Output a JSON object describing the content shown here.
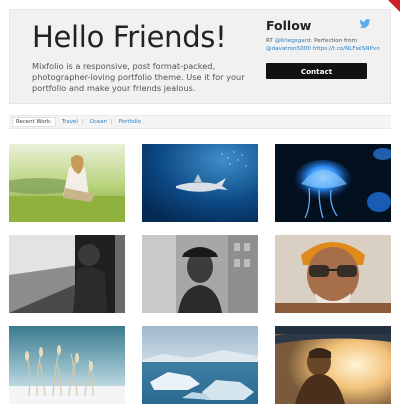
{
  "hero": {
    "title": "Hello Friends!",
    "description": "Mixfolio is a responsive, post format-packed, photographer-loving portfolio theme. Use it for your portfolio and make your friends jealous."
  },
  "follow": {
    "title": "Follow",
    "tweet_prefix": "RT ",
    "tweet_handle": "@Kriegsgard",
    "tweet_text": ": Perfection from ",
    "tweet_mention": "@davatron5000",
    "tweet_link": "https://t.co/NLFwISNPvn",
    "contact_label": "Contact"
  },
  "filters": {
    "label": "Recent Work:",
    "items": [
      "Travel",
      "Ocean",
      "Portfolio"
    ]
  },
  "gallery": {
    "items": [
      {
        "name": "girl-sitting-in-field"
      },
      {
        "name": "shark-underwater"
      },
      {
        "name": "blue-jellyfish"
      },
      {
        "name": "train-window-bw"
      },
      {
        "name": "man-with-cap-bw"
      },
      {
        "name": "old-man-with-glasses"
      },
      {
        "name": "frosted-reeds"
      },
      {
        "name": "icebergs"
      },
      {
        "name": "surfer-with-board"
      }
    ]
  },
  "colors": {
    "accent": "#d0202a",
    "link": "#2a7fc1",
    "button": "#111111",
    "twitter": "#55acee"
  }
}
